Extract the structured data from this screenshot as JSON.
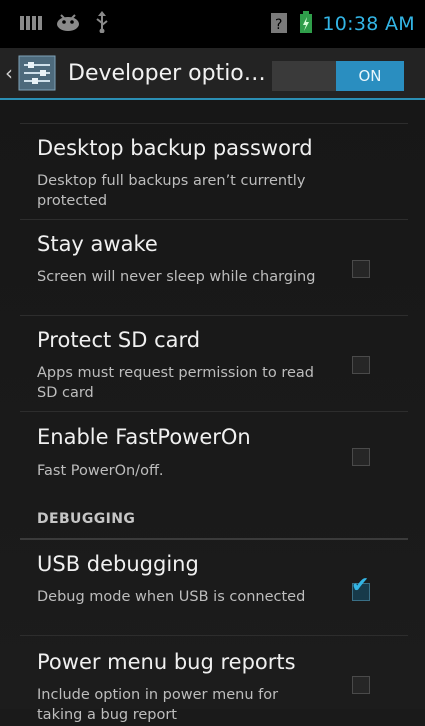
{
  "status_bar": {
    "time": "10:38 AM",
    "icons": [
      "notification-icon",
      "android-debug-icon",
      "usb-icon",
      "no-sim-icon",
      "battery-icon"
    ]
  },
  "action_bar": {
    "title": "Developer optio…",
    "switch_label": "ON",
    "icon": "developer-options-icon"
  },
  "settings": [
    {
      "title": "Desktop backup password",
      "summary": "Desktop full backups aren’t currently protected",
      "has_checkbox": false
    },
    {
      "title": "Stay awake",
      "summary": "Screen will never sleep while charging",
      "checked": false
    },
    {
      "title": "Protect SD card",
      "summary": "Apps must request permission to read SD card",
      "checked": false
    },
    {
      "title": "Enable FastPowerOn",
      "summary": "Fast PowerOn/off.",
      "checked": false
    }
  ],
  "section": {
    "label": "DEBUGGING"
  },
  "debug_settings": [
    {
      "title": "USB debugging",
      "summary": "Debug mode when USB is connected",
      "checked": true
    },
    {
      "title": "Power menu bug reports",
      "summary": "Include option in power menu for taking a bug report",
      "checked": false
    }
  ],
  "colors": {
    "accent": "#33b5e5",
    "switch_on": "#2a8ec0",
    "background": "#1a1a1a"
  }
}
